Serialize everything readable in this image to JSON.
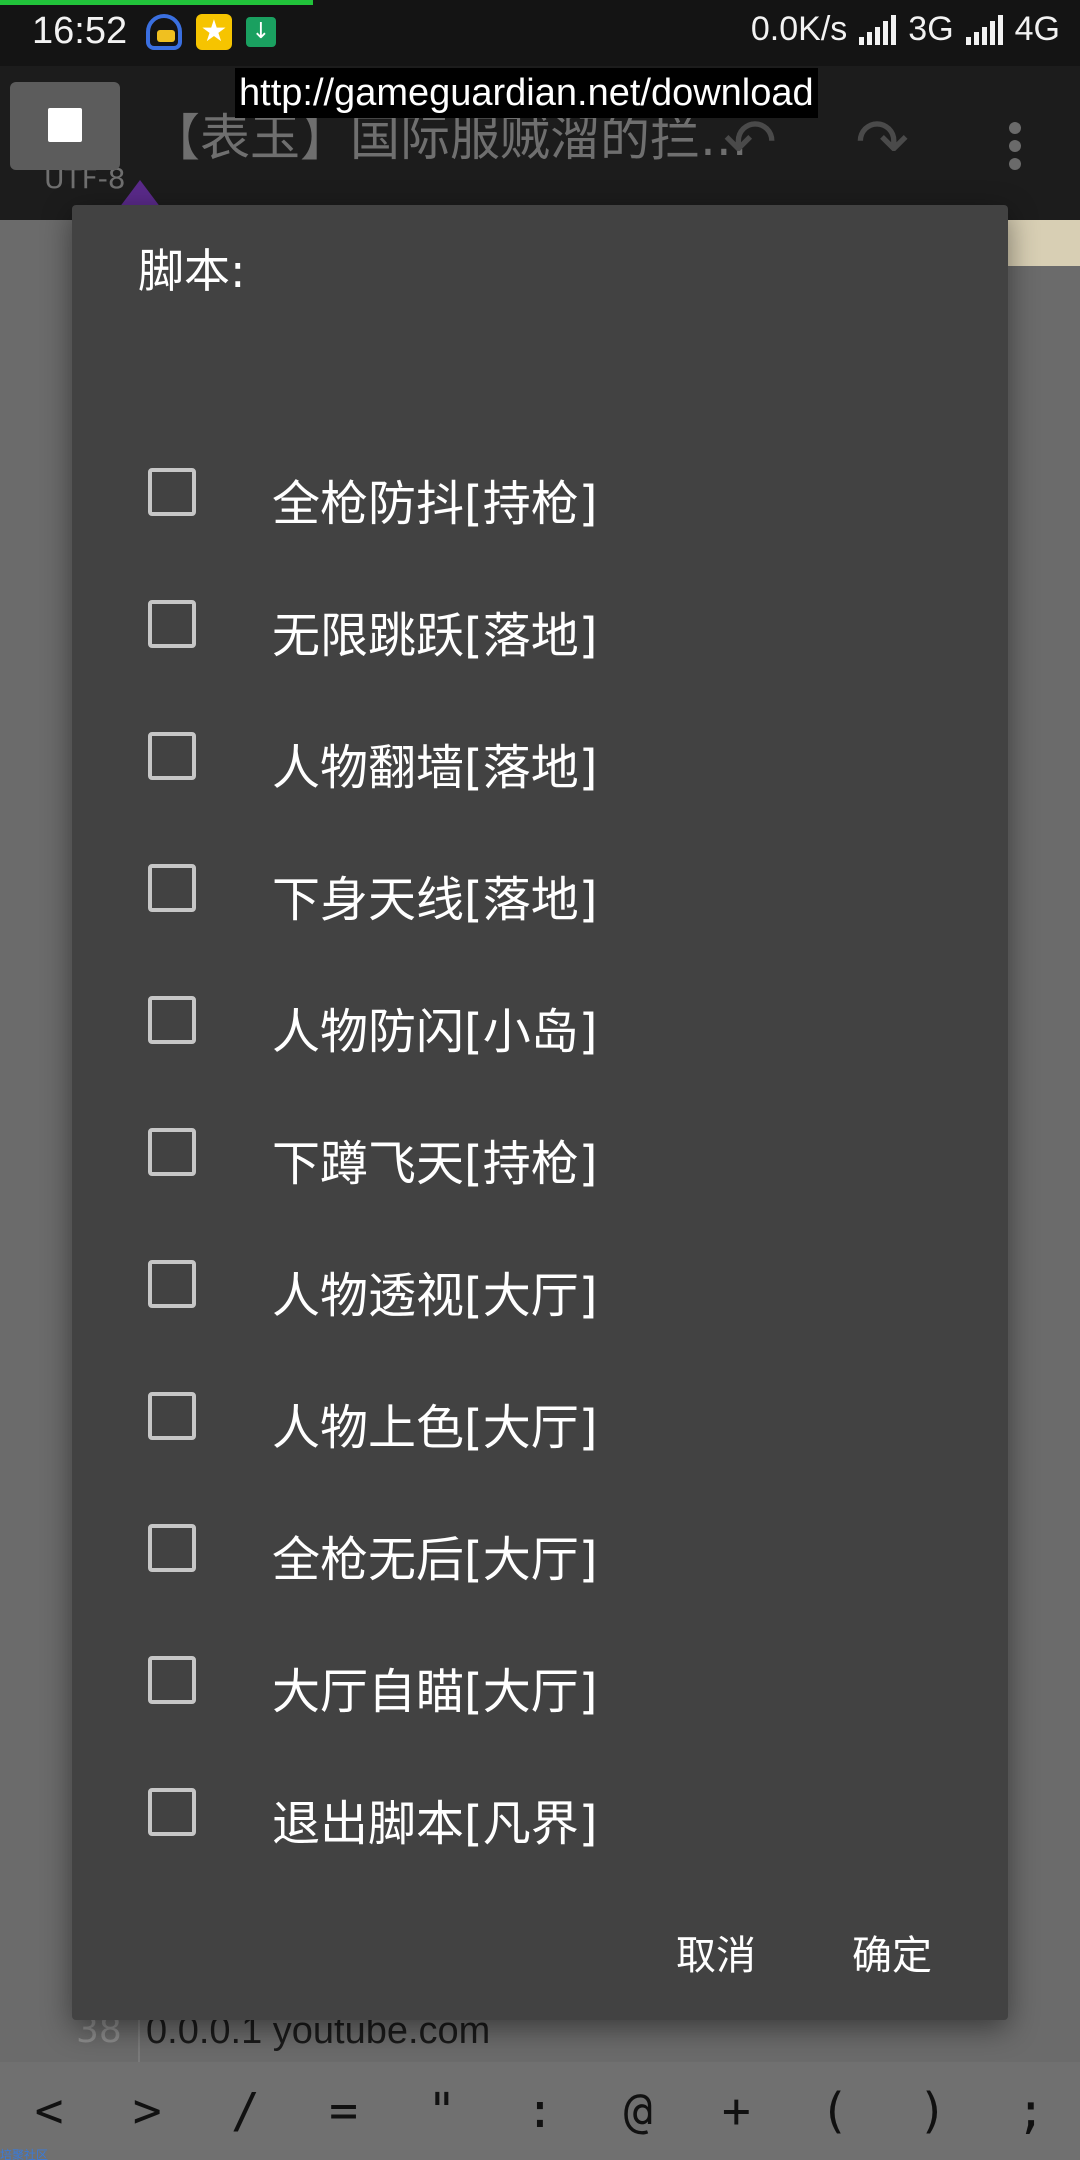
{
  "status_bar": {
    "time": "16:52",
    "net_speed": "0.0K/s",
    "net1": "3G",
    "net2": "4G",
    "icons": [
      "headset-icon",
      "star-icon",
      "download-icon",
      "signal-icon"
    ]
  },
  "toolbar": {
    "title": "【表玉】国际服贼溜的拦...",
    "encoding": "UTF-8",
    "undo_icon": "undo-icon",
    "redo_icon": "redo-icon",
    "more_icon": "more-vertical-icon"
  },
  "url_tip": "http://gameguardian.net/download",
  "dialog": {
    "title": "脚本:",
    "options": [
      {
        "label": "全枪防抖[持枪]",
        "checked": false
      },
      {
        "label": "无限跳跃[落地]",
        "checked": false
      },
      {
        "label": "人物翻墙[落地]",
        "checked": false
      },
      {
        "label": "下身天线[落地]",
        "checked": false
      },
      {
        "label": "人物防闪[小岛]",
        "checked": false
      },
      {
        "label": "下蹲飞天[持枪]",
        "checked": false
      },
      {
        "label": "人物透视[大厅]",
        "checked": false
      },
      {
        "label": "人物上色[大厅]",
        "checked": false
      },
      {
        "label": "全枪无后[大厅]",
        "checked": false
      },
      {
        "label": "大厅自瞄[大厅]",
        "checked": false
      },
      {
        "label": "退出脚本[凡界]",
        "checked": false
      }
    ],
    "cancel": "取消",
    "ok": "确定"
  },
  "editor": {
    "line_number": "38",
    "line_text": "0.0.0.1 youtube.com"
  },
  "symbols": [
    "<",
    ">",
    "/",
    "=",
    "\"",
    ":",
    "@",
    "+",
    "(",
    ")",
    ";"
  ],
  "corner_tag": "培聚社区",
  "colors": {
    "dialog_bg": "#424242",
    "statusbar_bg": "#141414",
    "progress": "#21c23a",
    "checkbox_border": "#c6c6c6"
  }
}
